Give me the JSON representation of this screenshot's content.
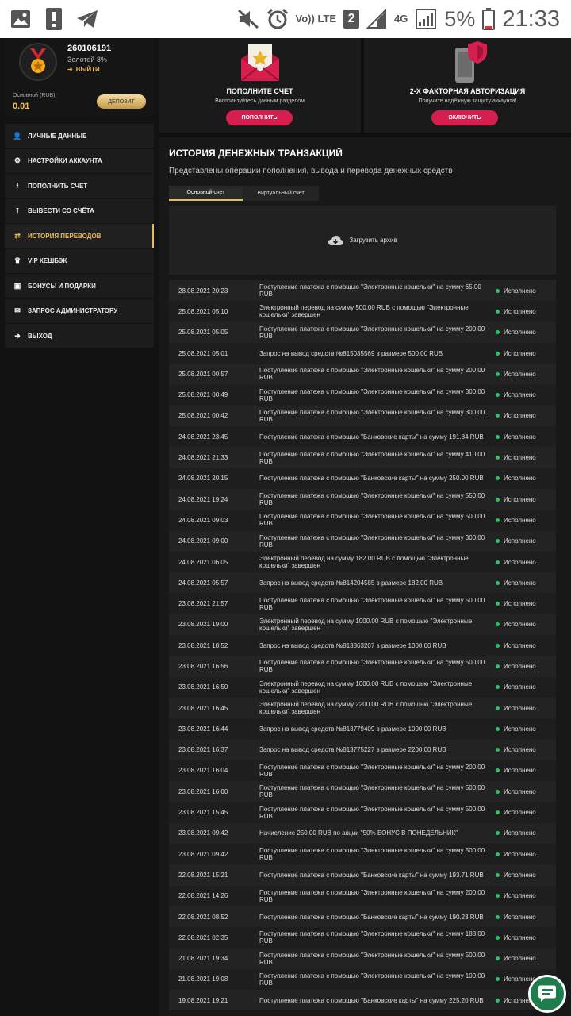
{
  "status_bar": {
    "battery": "5%",
    "time": "21:33",
    "volte": "Vo)) LTE",
    "sim": "2",
    "network": "4G"
  },
  "profile": {
    "user_id": "260106191",
    "level": "Золотой 8%",
    "logout": "ВЫЙТИ",
    "account_label": "Основной (RUB)",
    "balance": "0.01",
    "deposit_button": "ДЕПОЗИТ"
  },
  "menu": [
    {
      "label": "ЛИЧНЫЕ ДАННЫЕ",
      "icon": "user-plus-icon"
    },
    {
      "label": "НАСТРОЙКИ АККАУНТА",
      "icon": "gears-icon"
    },
    {
      "label": "ПОПОЛНИТЬ СЧЁТ",
      "icon": "download-icon"
    },
    {
      "label": "ВЫВЕСТИ СО СЧЁТА",
      "icon": "upload-icon"
    },
    {
      "label": "ИСТОРИЯ ПЕРЕВОДОВ",
      "icon": "exchange-icon"
    },
    {
      "label": "VIP КЕШБЭК",
      "icon": "crown-icon"
    },
    {
      "label": "БОНУСЫ И ПОДАРКИ",
      "icon": "gift-icon"
    },
    {
      "label": "ЗАПРОС АДМИНИСТРАТОРУ",
      "icon": "envelope-icon"
    },
    {
      "label": "ВЫХОД",
      "icon": "sign-out-icon"
    }
  ],
  "promos": [
    {
      "title": "ПОПОЛНИТЕ СЧЕТ",
      "subtitle": "Воспользуйтесь данным разделом",
      "button": "ПОПОЛНИТЬ"
    },
    {
      "title": "2-Х ФАКТОРНАЯ АВТОРИЗАЦИЯ",
      "subtitle": "Получите надёжную защиту аккаунта!",
      "button": "ВКЛЮЧИТЬ"
    }
  ],
  "history": {
    "title": "ИСТОРИЯ ДЕНЕЖНЫХ ТРАНЗАКЦИЙ",
    "subtitle": "Представлены операции пополнения, вывода и перевода денежных средств",
    "tabs": [
      "Основной счет",
      "Виртуальный счет"
    ],
    "archive": "Загрузить архив",
    "rows": [
      {
        "date": "28.08.2021 20:23",
        "desc": "Поступление платежа с помощью \"Электронные кошельки\" на сумму 65.00 RUB",
        "status": "Исполнено"
      },
      {
        "date": "25.08.2021 05:10",
        "desc": "Электронный перевод на сумму 500.00 RUB с помощью \"Электронные кошельки\" завершен",
        "status": "Исполнено"
      },
      {
        "date": "25.08.2021 05:05",
        "desc": "Поступление платежа с помощью \"Электронные кошельки\" на сумму 200.00 RUB",
        "status": "Исполнено"
      },
      {
        "date": "25.08.2021 05:01",
        "desc": "Запрос на вывод средств №815035569 в размере 500.00 RUB",
        "status": "Исполнено"
      },
      {
        "date": "25.08.2021 00:57",
        "desc": "Поступление платежа с помощью \"Электронные кошельки\" на сумму 200.00 RUB",
        "status": "Исполнено"
      },
      {
        "date": "25.08.2021 00:49",
        "desc": "Поступление платежа с помощью \"Электронные кошельки\" на сумму 300.00 RUB",
        "status": "Исполнено"
      },
      {
        "date": "25.08.2021 00:42",
        "desc": "Поступление платежа с помощью \"Электронные кошельки\" на сумму 300.00 RUB",
        "status": "Исполнено"
      },
      {
        "date": "24.08.2021 23:45",
        "desc": "Поступление платежа с помощью \"Банковские карты\" на сумму 191.84 RUB",
        "status": "Исполнено"
      },
      {
        "date": "24.08.2021 21:33",
        "desc": "Поступление платежа с помощью \"Электронные кошельки\" на сумму 410.00 RUB",
        "status": "Исполнено"
      },
      {
        "date": "24.08.2021 20:15",
        "desc": "Поступление платежа с помощью \"Банковские карты\" на сумму 250.00 RUB",
        "status": "Исполнено"
      },
      {
        "date": "24.08.2021 19:24",
        "desc": "Поступление платежа с помощью \"Электронные кошельки\" на сумму 550.00 RUB",
        "status": "Исполнено"
      },
      {
        "date": "24.08.2021 09:03",
        "desc": "Поступление платежа с помощью \"Электронные кошельки\" на сумму 500.00 RUB",
        "status": "Исполнено"
      },
      {
        "date": "24.08.2021 09:00",
        "desc": "Поступление платежа с помощью \"Электронные кошельки\" на сумму 300.00 RUB",
        "status": "Исполнено"
      },
      {
        "date": "24.08.2021 06:05",
        "desc": "Электронный перевод на сумму 182.00 RUB с помощью \"Электронные кошельки\" завершен",
        "status": "Исполнено"
      },
      {
        "date": "24.08.2021 05:57",
        "desc": "Запрос на вывод средств №814204585 в размере 182.00 RUB",
        "status": "Исполнено"
      },
      {
        "date": "23.08.2021 21:57",
        "desc": "Поступление платежа с помощью \"Электронные кошельки\" на сумму 500.00 RUB",
        "status": "Исполнено"
      },
      {
        "date": "23.08.2021 19:00",
        "desc": "Электронный перевод на сумму 1000.00 RUB с помощью \"Электронные кошельки\" завершен",
        "status": "Исполнено"
      },
      {
        "date": "23.08.2021 18:52",
        "desc": "Запрос на вывод средств №813863207 в размере 1000.00 RUB",
        "status": "Исполнено"
      },
      {
        "date": "23.08.2021 16:56",
        "desc": "Поступление платежа с помощью \"Электронные кошельки\" на сумму 500.00 RUB",
        "status": "Исполнено"
      },
      {
        "date": "23.08.2021 16:50",
        "desc": "Электронный перевод на сумму 1000.00 RUB с помощью \"Электронные кошельки\" завершен",
        "status": "Исполнено"
      },
      {
        "date": "23.08.2021 16:45",
        "desc": "Электронный перевод на сумму 2200.00 RUB с помощью \"Электронные кошельки\" завершен",
        "status": "Исполнено"
      },
      {
        "date": "23.08.2021 16:44",
        "desc": "Запрос на вывод средств №813779409 в размере 1000.00 RUB",
        "status": "Исполнено"
      },
      {
        "date": "23.08.2021 16:37",
        "desc": "Запрос на вывод средств №813775227 в размере 2200.00 RUB",
        "status": "Исполнено"
      },
      {
        "date": "23.08.2021 16:04",
        "desc": "Поступление платежа с помощью \"Электронные кошельки\" на сумму 200.00 RUB",
        "status": "Исполнено"
      },
      {
        "date": "23.08.2021 16:00",
        "desc": "Поступление платежа с помощью \"Электронные кошельки\" на сумму 500.00 RUB",
        "status": "Исполнено"
      },
      {
        "date": "23.08.2021 15:45",
        "desc": "Поступление платежа с помощью \"Электронные кошельки\" на сумму 500.00 RUB",
        "status": "Исполнено"
      },
      {
        "date": "23.08.2021 09:42",
        "desc": "Начисление 250.00 RUB по акции \"50% БОНУС В ПОНЕДЕЛЬНИК\"",
        "status": "Исполнено"
      },
      {
        "date": "23.08.2021 09:42",
        "desc": "Поступление платежа с помощью \"Электронные кошельки\" на сумму 500.00 RUB",
        "status": "Исполнено"
      },
      {
        "date": "22.08.2021 15:21",
        "desc": "Поступление платежа с помощью \"Банковские карты\" на сумму 193.71 RUB",
        "status": "Исполнено"
      },
      {
        "date": "22.08.2021 14:26",
        "desc": "Поступление платежа с помощью \"Электронные кошельки\" на сумму 200.00 RUB",
        "status": "Исполнено"
      },
      {
        "date": "22.08.2021 08:52",
        "desc": "Поступление платежа с помощью \"Банковские карты\" на сумму 190.23 RUB",
        "status": "Исполнено"
      },
      {
        "date": "22.08.2021 02:35",
        "desc": "Поступление платежа с помощью \"Электронные кошельки\" на сумму 188.00 RUB",
        "status": "Исполнено"
      },
      {
        "date": "21.08.2021 19:34",
        "desc": "Поступление платежа с помощью \"Электронные кошельки\" на сумму 500.00 RUB",
        "status": "Исполнено"
      },
      {
        "date": "21.08.2021 19:08",
        "desc": "Поступление платежа с помощью \"Электронные кошельки\" на сумму 100.00 RUB",
        "status": "Исполнено"
      },
      {
        "date": "19.08.2021 19:21",
        "desc": "Поступление платежа с помощью \"Банковские карты\" на сумму 225.20 RUB",
        "status": "Исполнено"
      }
    ]
  },
  "colors": {
    "accent_gold": "#e6bb5b",
    "button_red": "#d51f4e",
    "status_green": "#24c95b"
  }
}
